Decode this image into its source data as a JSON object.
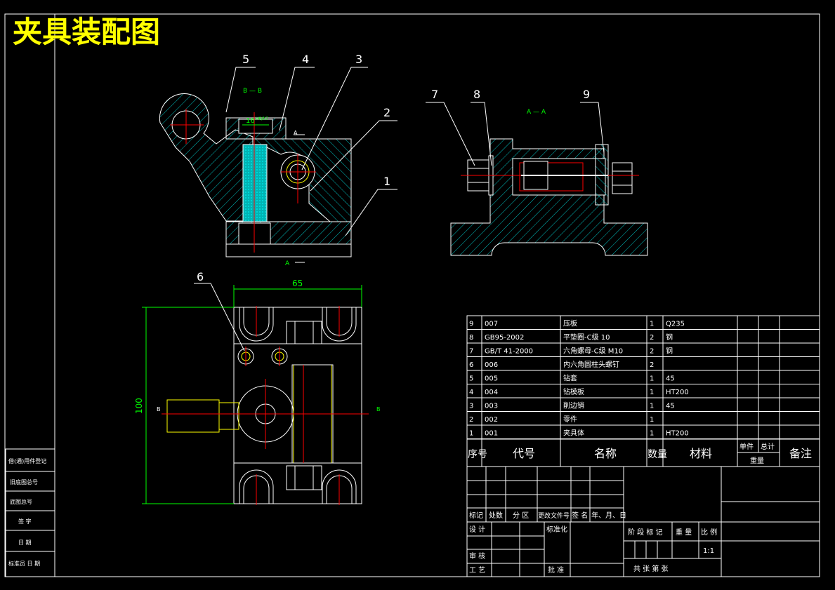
{
  "title": "夹具装配图",
  "colors": {
    "background": "#000000",
    "line": "#ffffff",
    "title": "#ffff00",
    "centerline": "#ff0000",
    "hatch": "#00cccc",
    "dimension": "#00ff00",
    "hidden": "#ffff00"
  },
  "section_labels": {
    "bb_top": "B — B",
    "aa_right": "A — A",
    "a_mark": "A",
    "b_mark": "B"
  },
  "balloons": [
    "1",
    "2",
    "3",
    "4",
    "5",
    "6",
    "7",
    "8",
    "9"
  ],
  "dimensions": {
    "width_65": "65",
    "height_100": "100",
    "slot_16": "16",
    "slot_tol": "H8/h7"
  },
  "bom": {
    "rows": [
      {
        "no": "9",
        "code": "007",
        "name": "压板",
        "qty": "1",
        "material": "Q235"
      },
      {
        "no": "8",
        "code": "GB95-2002",
        "name": "平垫圈-C级 10",
        "qty": "2",
        "material": "钢"
      },
      {
        "no": "7",
        "code": "GB/T 41-2000",
        "name": "六角螺母-C级 M10",
        "qty": "2",
        "material": "钢"
      },
      {
        "no": "6",
        "code": "006",
        "name": "内六角圆柱头螺钉",
        "qty": "2",
        "material": ""
      },
      {
        "no": "5",
        "code": "005",
        "name": "钻套",
        "qty": "1",
        "material": "45"
      },
      {
        "no": "4",
        "code": "004",
        "name": "钻模板",
        "qty": "1",
        "material": "HT200"
      },
      {
        "no": "3",
        "code": "003",
        "name": "削边销",
        "qty": "1",
        "material": "45"
      },
      {
        "no": "2",
        "code": "002",
        "name": "零件",
        "qty": "1",
        "material": ""
      },
      {
        "no": "1",
        "code": "001",
        "name": "夹具体",
        "qty": "1",
        "material": "HT200"
      }
    ],
    "headers": {
      "no": "序号",
      "code": "代号",
      "name": "名称",
      "qty": "数量",
      "material": "材料",
      "unit": "单件",
      "total": "总计",
      "weight": "重量",
      "remark": "备注"
    }
  },
  "title_block": {
    "mark": "标记",
    "count": "处数",
    "zone": "分 区",
    "doc": "更改文件号",
    "sign": "签 名",
    "date": "年、月、日",
    "design": "设 计",
    "standard": "标准化",
    "review": "审 核",
    "process": "工 艺",
    "approve": "批 准",
    "stage": "阶 段 标 记",
    "weight": "重 量",
    "scale": "比 例",
    "scale_value": "1:1",
    "sheets": "共    张  第    张"
  },
  "left_block": [
    "借(通)用件登记",
    "旧底图总号",
    "底图总号",
    "签 字",
    "日 期",
    "标准员 日 期"
  ]
}
